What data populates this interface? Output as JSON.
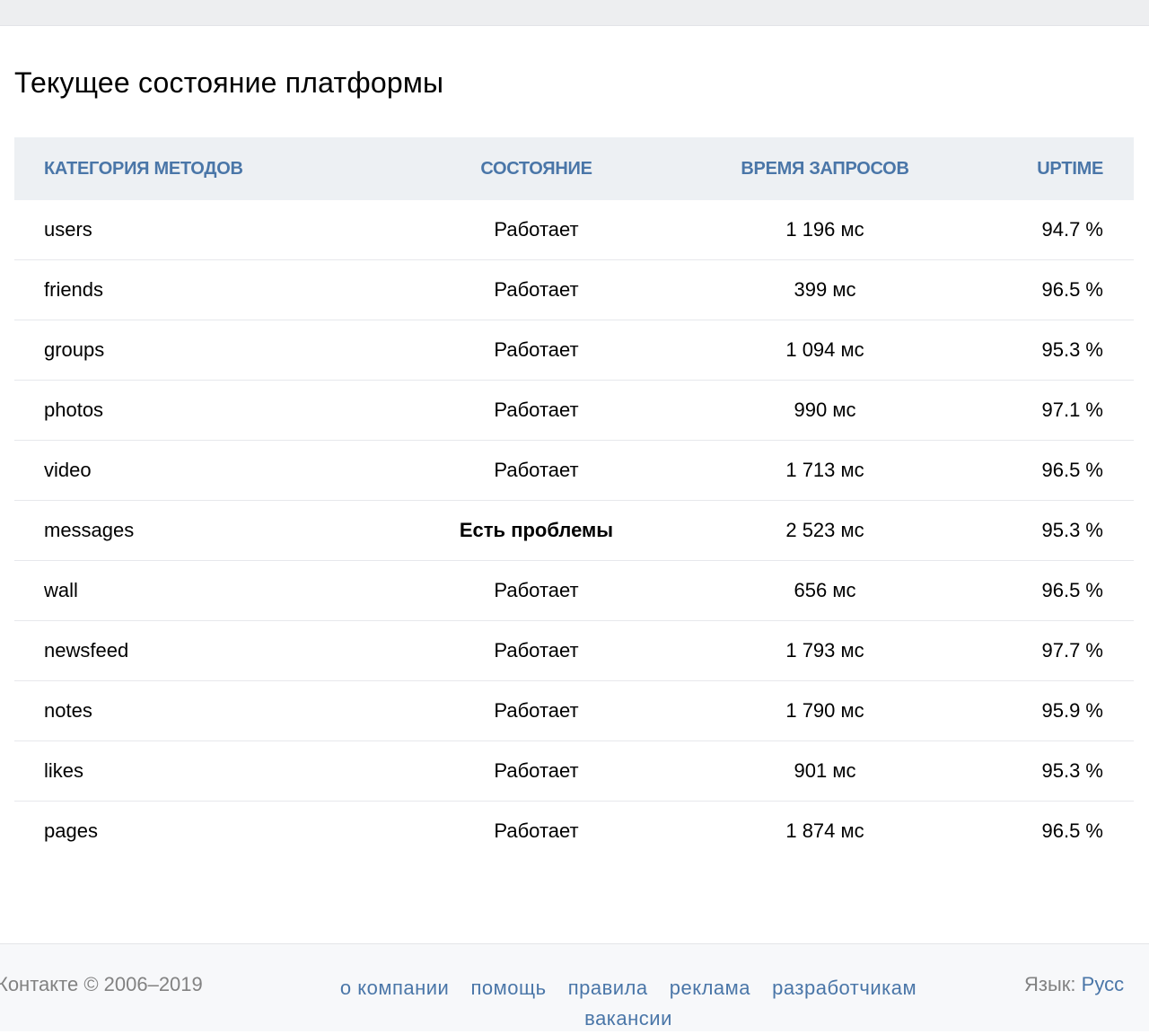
{
  "page_title": "Текущее состояние платформы",
  "table": {
    "headers": [
      "Категория методов",
      "Состояние",
      "Время запросов",
      "Uptime"
    ],
    "rows": [
      {
        "category": "users",
        "status": "Работает",
        "time": "1 196 мс",
        "uptime": "94.7 %"
      },
      {
        "category": "friends",
        "status": "Работает",
        "time": "399 мс",
        "uptime": "96.5 %"
      },
      {
        "category": "groups",
        "status": "Работает",
        "time": "1 094 мс",
        "uptime": "95.3 %"
      },
      {
        "category": "photos",
        "status": "Работает",
        "time": "990 мс",
        "uptime": "97.1 %"
      },
      {
        "category": "video",
        "status": "Работает",
        "time": "1 713 мс",
        "uptime": "96.5 %"
      },
      {
        "category": "messages",
        "status": "Есть проблемы",
        "time": "2 523 мс",
        "uptime": "95.3 %"
      },
      {
        "category": "wall",
        "status": "Работает",
        "time": "656 мс",
        "uptime": "96.5 %"
      },
      {
        "category": "newsfeed",
        "status": "Работает",
        "time": "1 793 мс",
        "uptime": "97.7 %"
      },
      {
        "category": "notes",
        "status": "Работает",
        "time": "1 790 мс",
        "uptime": "95.9 %"
      },
      {
        "category": "likes",
        "status": "Работает",
        "time": "901 мс",
        "uptime": "95.3 %"
      },
      {
        "category": "pages",
        "status": "Работает",
        "time": "1 874 мс",
        "uptime": "96.5 %"
      }
    ]
  },
  "footer": {
    "copyright": "Контакте © 2006–2019",
    "links": [
      "о компании",
      "помощь",
      "правила",
      "реклама",
      "разработчикам",
      "вакансии"
    ],
    "language_label": "Язык:",
    "language_value": "Русс"
  },
  "colors": {
    "accent": "#4a76a8",
    "problem": "#e5a81e",
    "header_bg": "#edf0f3"
  }
}
